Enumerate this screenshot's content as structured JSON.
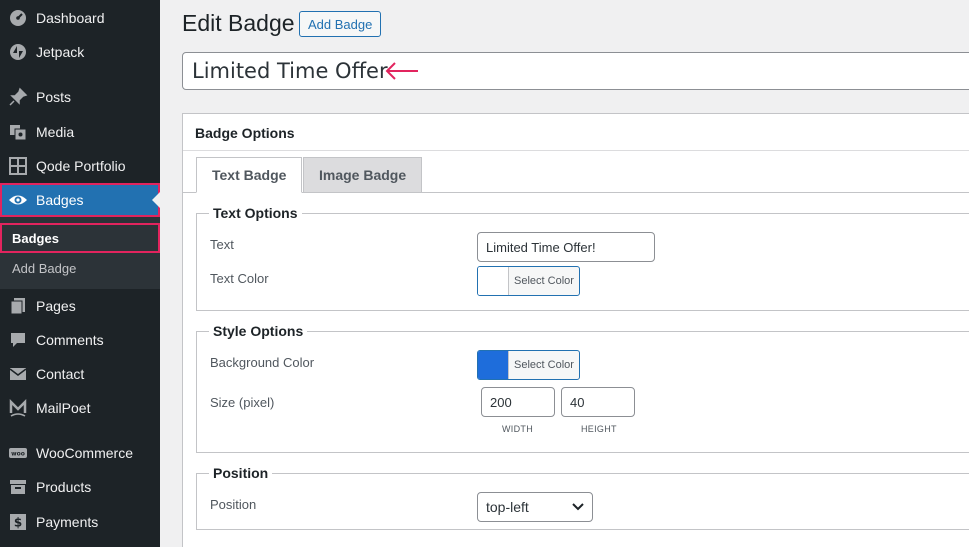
{
  "sidebar": {
    "items": [
      {
        "label": "Dashboard",
        "icon": "dashboard-icon"
      },
      {
        "label": "Jetpack",
        "icon": "jetpack-icon"
      },
      {
        "label": "Posts",
        "icon": "pin-icon"
      },
      {
        "label": "Media",
        "icon": "media-icon"
      },
      {
        "label": "Qode Portfolio",
        "icon": "grid-icon"
      },
      {
        "label": "Badges",
        "icon": "eye-icon",
        "active": true
      },
      {
        "label": "Pages",
        "icon": "pages-icon"
      },
      {
        "label": "Comments",
        "icon": "comment-icon"
      },
      {
        "label": "Contact",
        "icon": "mail-icon"
      },
      {
        "label": "MailPoet",
        "icon": "mailpoet-icon"
      },
      {
        "label": "WooCommerce",
        "icon": "woo-icon"
      },
      {
        "label": "Products",
        "icon": "archive-icon"
      },
      {
        "label": "Payments",
        "icon": "dollar-icon"
      }
    ],
    "submenu": [
      {
        "label": "Badges",
        "current": true
      },
      {
        "label": "Add Badge"
      }
    ]
  },
  "header": {
    "title": "Edit Badge",
    "add_button": "Add Badge"
  },
  "post_title": "Limited Time Offer",
  "badge_options": {
    "title": "Badge Options",
    "tabs": [
      "Text Badge",
      "Image Badge"
    ],
    "text_options": {
      "legend": "Text Options",
      "text_label": "Text",
      "text_value": "Limited Time Offer!",
      "text_color_label": "Text Color",
      "select_color": "Select Color",
      "text_color": "#ffffff"
    },
    "style_options": {
      "legend": "Style Options",
      "bg_label": "Background Color",
      "select_color": "Select Color",
      "bg_color": "#1e6ddb",
      "size_label": "Size (pixel)",
      "width": "200",
      "height": "40",
      "width_caption": "WIDTH",
      "height_caption": "HEIGHT"
    },
    "position": {
      "legend": "Position",
      "label": "Position",
      "value": "top-left"
    }
  },
  "colors": {
    "accent": "#2271b1",
    "highlight": "#e2245e",
    "sidebar_bg": "#1d2327"
  }
}
